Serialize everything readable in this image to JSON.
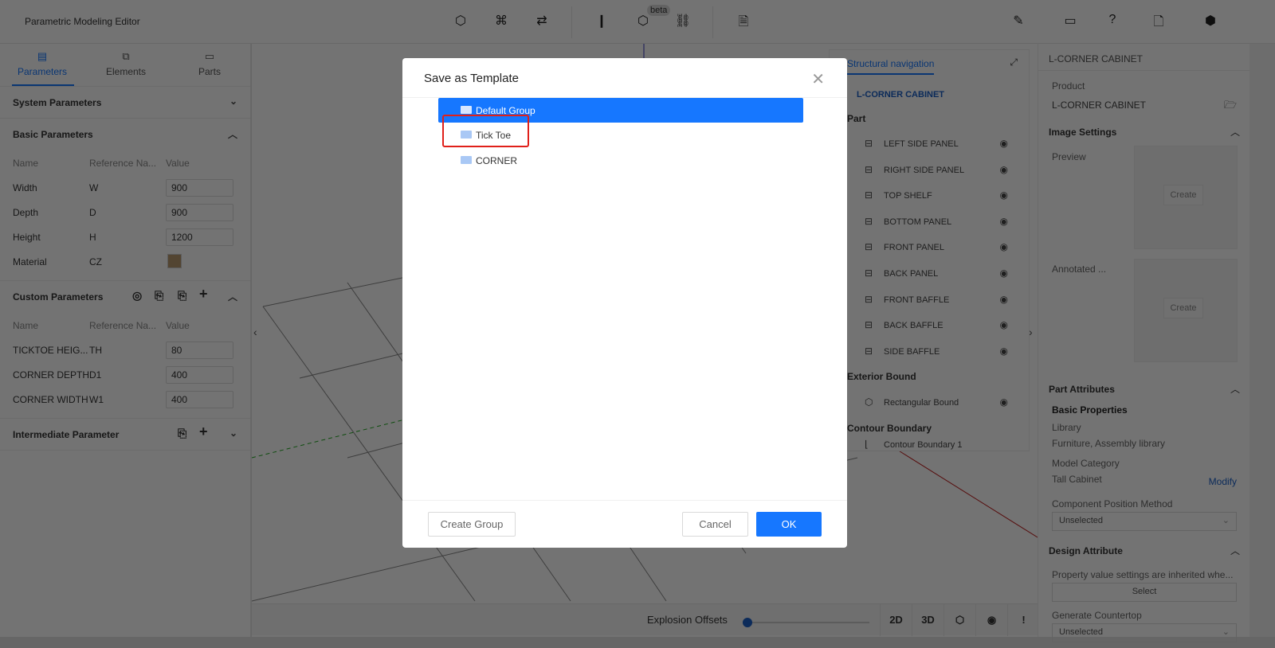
{
  "app": {
    "title": "Parametric Modeling Editor",
    "beta": "beta"
  },
  "left": {
    "tabs": [
      {
        "label": "Parameters"
      },
      {
        "label": "Elements"
      },
      {
        "label": "Parts"
      }
    ],
    "system_params": "System Parameters",
    "basic_params": "Basic Parameters",
    "headers": {
      "name": "Name",
      "ref": "Reference Na...",
      "value": "Value"
    },
    "basic_rows": [
      {
        "name": "Width",
        "ref": "W",
        "value": "900"
      },
      {
        "name": "Depth",
        "ref": "D",
        "value": "900"
      },
      {
        "name": "Height",
        "ref": "H",
        "value": "1200"
      },
      {
        "name": "Material",
        "ref": "CZ",
        "value": ""
      }
    ],
    "custom_params": "Custom Parameters",
    "custom_rows": [
      {
        "name": "TICKTOE HEIG...",
        "ref": "TH",
        "value": "80"
      },
      {
        "name": "CORNER DEPTH",
        "ref": "D1",
        "value": "400"
      },
      {
        "name": "CORNER WIDTH",
        "ref": "W1",
        "value": "400"
      }
    ],
    "intermediate": "Intermediate Parameter"
  },
  "nav": {
    "tab": "Structural navigation",
    "title": "L-CORNER CABINET",
    "part_group": "Part",
    "parts": [
      "LEFT SIDE PANEL",
      "RIGHT SIDE PANEL",
      "TOP SHELF",
      "BOTTOM PANEL",
      "FRONT PANEL",
      "BACK PANEL",
      "FRONT BAFFLE",
      "BACK BAFFLE",
      "SIDE BAFFLE"
    ],
    "exterior_group": "Exterior Bound",
    "exterior_item": "Rectangular Bound",
    "contour_group": "Contour Boundary",
    "contour_item": "Contour Boundary 1"
  },
  "right": {
    "header": "L-CORNER CABINET",
    "product_label": "Product",
    "product_value": "L-CORNER CABINET",
    "image_settings": "Image Settings",
    "preview": "Preview",
    "annotated": "Annotated ...",
    "create": "Create",
    "part_attributes": "Part Attributes",
    "basic_properties": "Basic Properties",
    "library_label": "Library",
    "library_value": "Furniture, Assembly library",
    "model_category_label": "Model Category",
    "model_category_value": "Tall Cabinet",
    "modify": "Modify",
    "position_label": "Component Position Method",
    "position_value": "Unselected",
    "design_attribute": "Design Attribute",
    "inherit_note": "Property value settings are inherited whe...",
    "select": "Select",
    "countertop_label": "Generate Countertop",
    "countertop_value": "Unselected"
  },
  "bottom": {
    "explosion": "Explosion Offsets",
    "explosion_value": 0,
    "btn_2d": "2D",
    "btn_3d": "3D"
  },
  "dialog": {
    "title": "Save as Template",
    "groups": [
      {
        "label": "Default Group",
        "selected": true
      },
      {
        "label": "Tick Toe",
        "selected": false
      },
      {
        "label": "CORNER",
        "selected": false
      }
    ],
    "create_group": "Create Group",
    "cancel": "Cancel",
    "ok": "OK"
  },
  "colors": {
    "accent": "#1677ff",
    "highlight": "#e0201a"
  }
}
